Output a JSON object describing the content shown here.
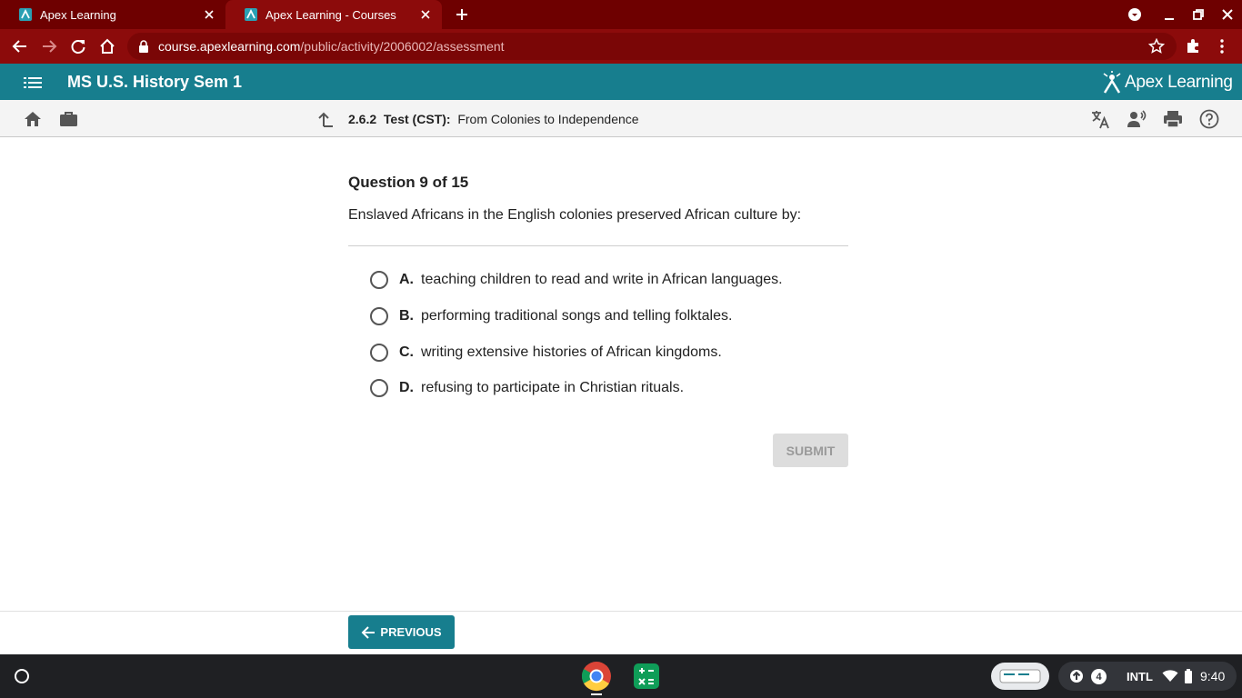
{
  "browser": {
    "tabs": [
      {
        "title": "Apex Learning",
        "active": false
      },
      {
        "title": "Apex Learning - Courses",
        "active": true
      }
    ],
    "url_host": "course.apexlearning.com",
    "url_path": "/public/activity/2006002/assessment"
  },
  "app": {
    "course_title": "MS U.S. History Sem 1",
    "brand": "Apex Learning",
    "accent_color": "#177e8e"
  },
  "activity": {
    "number": "2.6.2",
    "type": "Test (CST):",
    "title": "From Colonies to Independence"
  },
  "question": {
    "header": "Question 9 of 15",
    "text": "Enslaved Africans in the English colonies preserved African culture by:",
    "choices": [
      {
        "letter": "A.",
        "text": "teaching children to read and write in African languages."
      },
      {
        "letter": "B.",
        "text": "performing traditional songs and telling folktales."
      },
      {
        "letter": "C.",
        "text": "writing extensive histories of African kingdoms."
      },
      {
        "letter": "D.",
        "text": "refusing to participate in Christian rituals."
      }
    ],
    "submit_label": "SUBMIT"
  },
  "nav": {
    "previous_label": "PREVIOUS"
  },
  "shelf": {
    "notification_count": "4",
    "input_method": "INTL",
    "time": "9:40"
  }
}
